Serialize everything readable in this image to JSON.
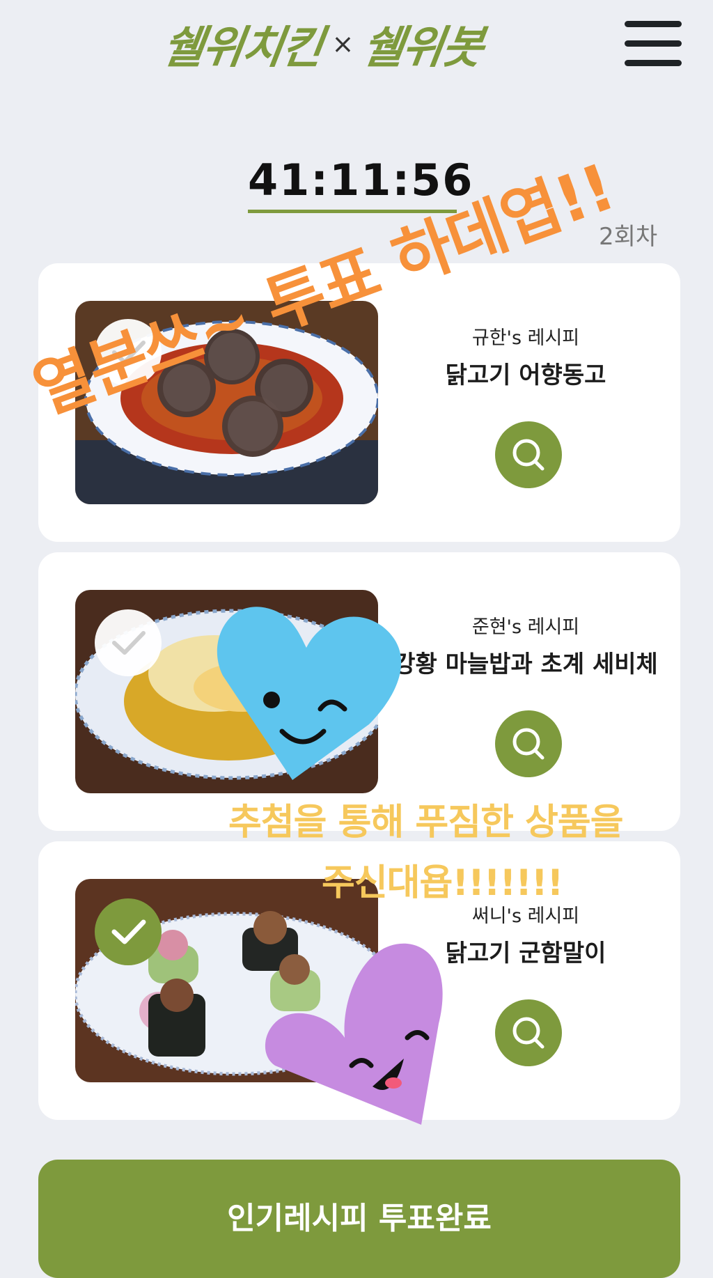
{
  "header": {
    "brand_left": "쉘위치킨",
    "brand_x": "×",
    "brand_right": "쉘위봇"
  },
  "timer": {
    "remaining": "41:11:56",
    "round": "2회차"
  },
  "recipes": [
    {
      "chef": "규한's 레시피",
      "dish": "닭고기 어향동고",
      "selected": false
    },
    {
      "chef": "준현's 레시피",
      "dish": "강황 마늘밥과 초계 세비체",
      "selected": false
    },
    {
      "chef": "써니's 레시피",
      "dish": "닭고기 군함말이",
      "selected": true
    }
  ],
  "vote_button": "인기레시피 투표완료",
  "stickers": {
    "headline": "열분쓰~ 투표 하데엽!!",
    "prize_line1": "추첨을 통해 푸짐한 상품을",
    "prize_line2": "주신대욥!!!!!!!"
  },
  "colors": {
    "accent": "#7e9a3d",
    "background": "#eceef3",
    "sticker_orange": "#f7913a",
    "sticker_yellow": "#f6c85c"
  },
  "icons": [
    "hamburger-menu-icon",
    "search-icon",
    "checkmark-icon",
    "heart-sticker-icon"
  ]
}
